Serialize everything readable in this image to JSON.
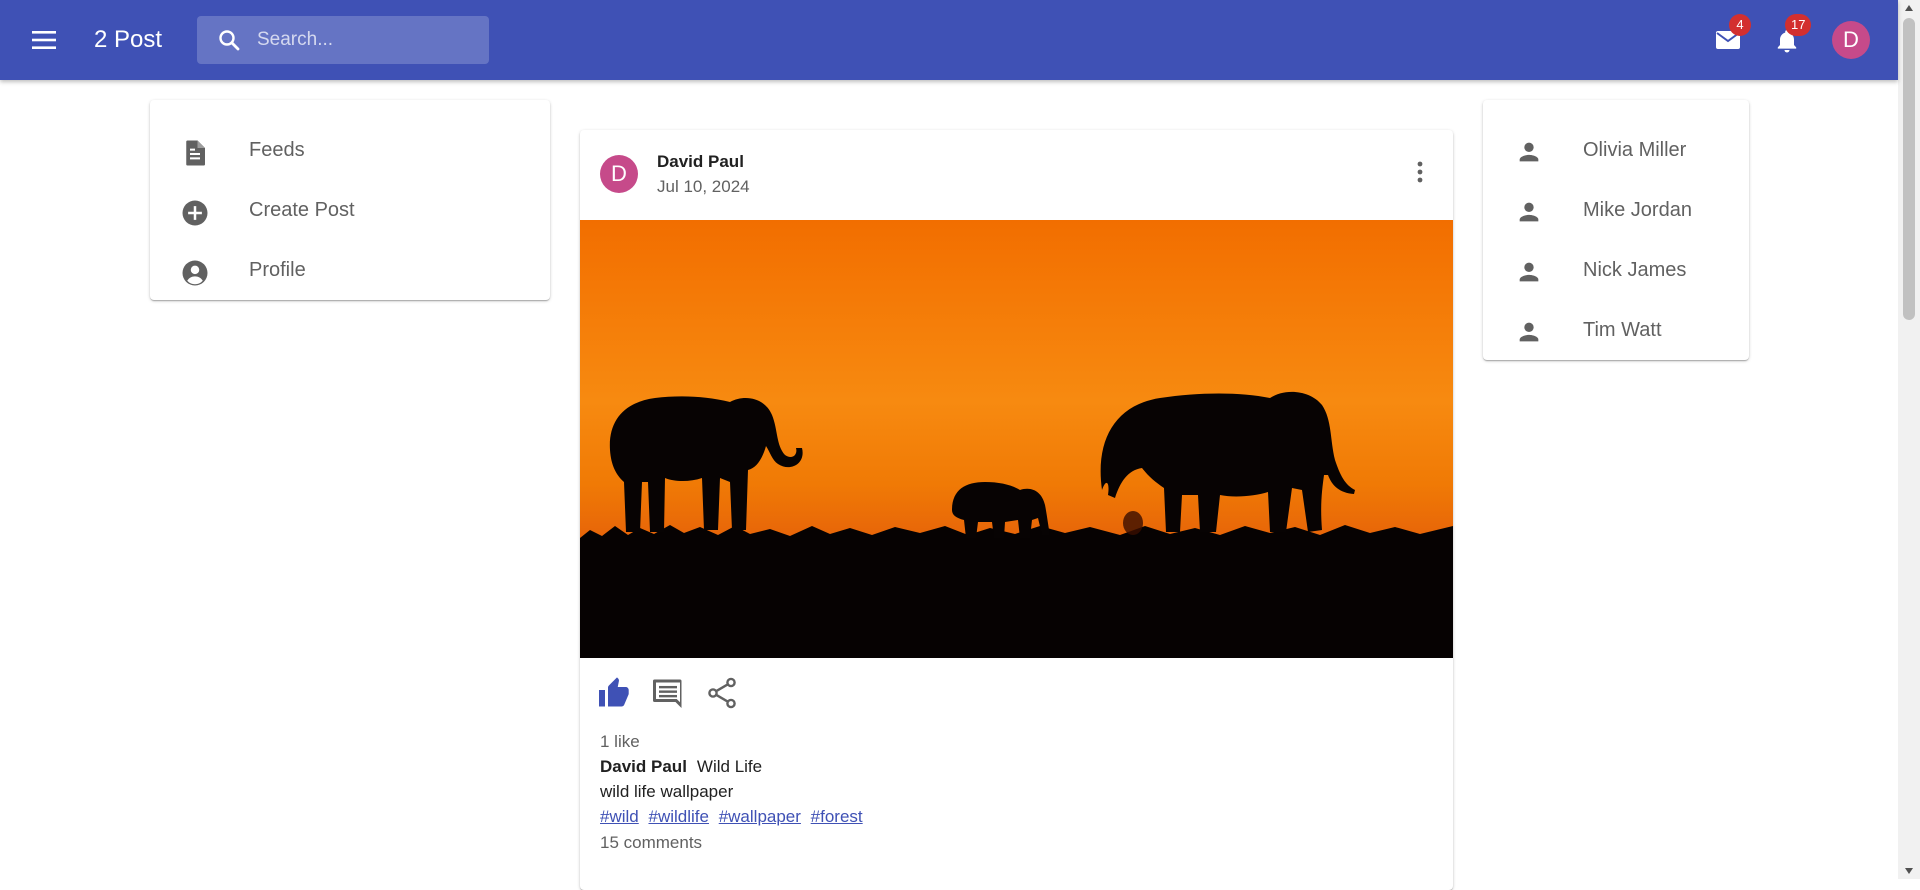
{
  "app": {
    "title": "2 Post"
  },
  "search": {
    "placeholder": "Search..."
  },
  "header": {
    "mail_badge": "4",
    "notifications_badge": "17",
    "avatar_initial": "D",
    "accent": "#3f51b5"
  },
  "sidebar": {
    "items": [
      {
        "label": "Feeds",
        "icon": "article-icon"
      },
      {
        "label": "Create Post",
        "icon": "add-circle-icon"
      },
      {
        "label": "Profile",
        "icon": "account-circle-icon"
      }
    ]
  },
  "friends": {
    "items": [
      {
        "name": "Olivia Miller",
        "icon": "person-icon"
      },
      {
        "name": "Mike Jordan",
        "icon": "person-icon"
      },
      {
        "name": "Nick James",
        "icon": "person-icon"
      },
      {
        "name": "Tim Watt",
        "icon": "person-icon"
      }
    ]
  },
  "post": {
    "avatar_initial": "D",
    "author": "David Paul",
    "date": "Jul 10, 2024",
    "likes": "1 like",
    "caption_author": "David Paul",
    "caption_title": "Wild Life",
    "description": "wild life wallpaper",
    "tags": [
      "#wild",
      "#wildlife",
      "#wallpaper",
      "#forest"
    ],
    "comments": "15 comments",
    "image_subject": "elephant silhouettes at sunset"
  }
}
